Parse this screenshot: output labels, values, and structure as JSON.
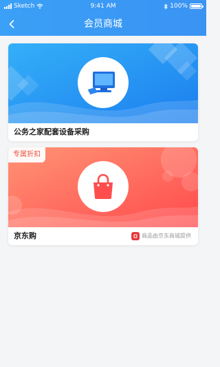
{
  "status_bar": {
    "carrier": "Sketch",
    "time": "9:41 AM",
    "battery": "100%",
    "battery_level": 1.0
  },
  "nav": {
    "title": "会员商城",
    "back_icon": "chevron-left-icon"
  },
  "cards": [
    {
      "title": "公务之家配套设备采购",
      "icon": "computer-icon",
      "accent": "#1f92f3"
    },
    {
      "title": "京东购",
      "badge": "专属折扣",
      "icon": "shopping-bag-icon",
      "provider_text": "商品由京东商城提供",
      "provider_icon": "jd-logo-icon",
      "accent": "#ff5a45"
    }
  ],
  "colors": {
    "header": "#3a97f5",
    "card1_gradient": [
      "#2fa6f6",
      "#1f82f0"
    ],
    "card2_gradient": [
      "#ff8a6a",
      "#ff4d4d"
    ],
    "background": "#f4f5f7"
  }
}
